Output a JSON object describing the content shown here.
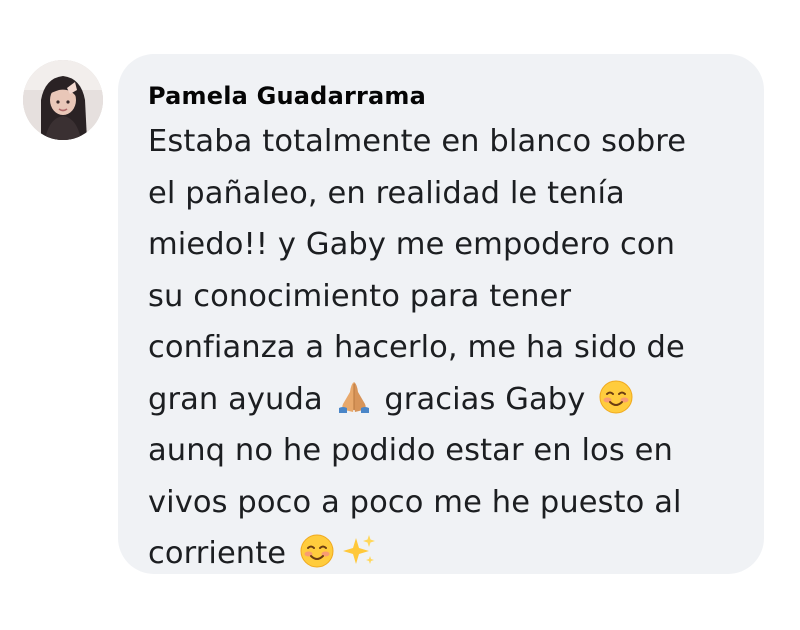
{
  "comment": {
    "author": "Pamela Guadarrama",
    "lines": [
      "Estaba totalmente en blanco sobre",
      "el pañaleo, en realidad le tenía",
      "miedo!! y Gaby me empodero con",
      "su conocimiento para tener",
      "confianza a hacerlo, me ha sido de",
      "gran ayuda",
      "gracias Gaby",
      "aunq no he podido estar en los en",
      "vivos poco a poco me he puesto al",
      "corriente"
    ],
    "emojis": [
      "praying-hands-emoji",
      "smiling-face-emoji",
      "sparkles-emoji"
    ]
  },
  "colors": {
    "bubble_background": "#f0f2f5",
    "page_background": "#ffffff",
    "text": "#1c1e21"
  }
}
